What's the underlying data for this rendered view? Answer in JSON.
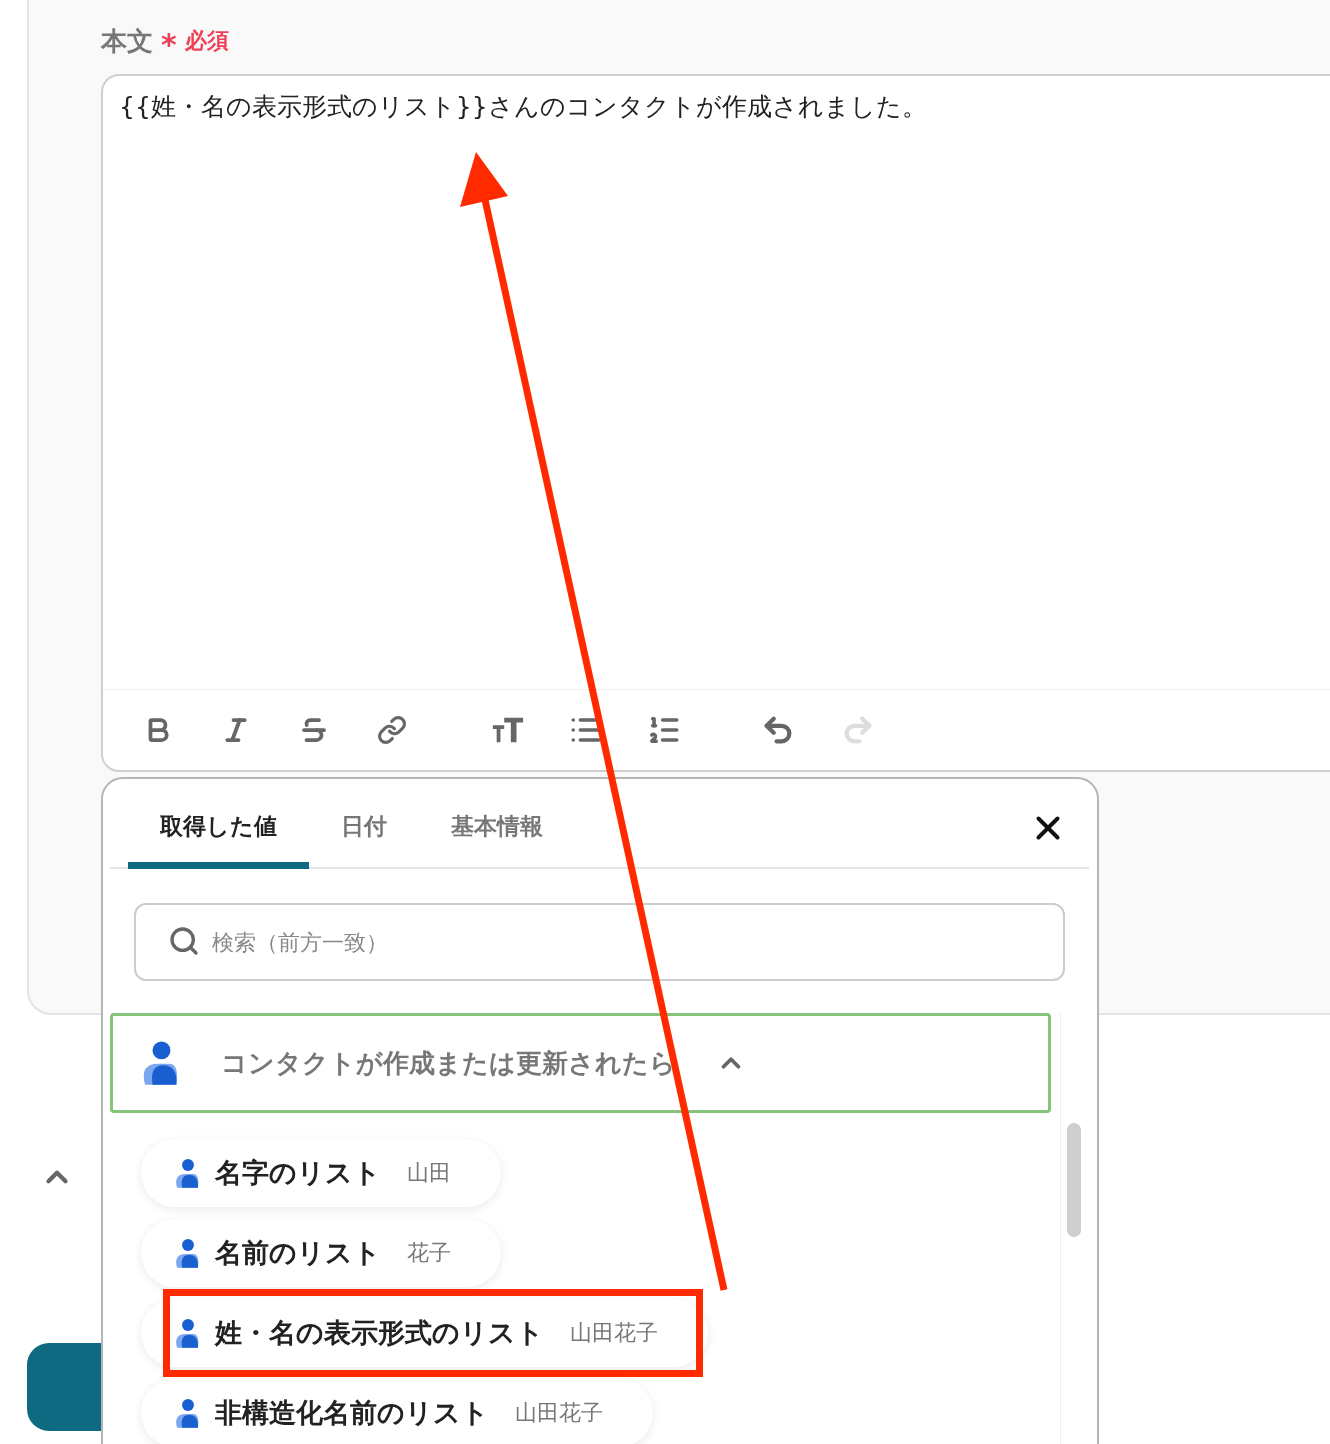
{
  "field": {
    "label": "本文",
    "required_mark": "*",
    "required_text": "必須",
    "value": "{{姓・名の表示形式のリスト}}さんのコンタクトが作成されました。"
  },
  "toolbar": [
    {
      "kind": "bold",
      "disabled": false
    },
    {
      "kind": "italic",
      "disabled": false
    },
    {
      "kind": "strike",
      "disabled": false
    },
    {
      "kind": "link",
      "disabled": false
    },
    {
      "kind": "size",
      "disabled": false
    },
    {
      "kind": "bullets",
      "disabled": false
    },
    {
      "kind": "numbers",
      "disabled": false
    },
    {
      "kind": "undo",
      "disabled": false
    },
    {
      "kind": "redo",
      "disabled": true
    }
  ],
  "popup": {
    "tabs": [
      {
        "label": "取得した値",
        "selected": true
      },
      {
        "label": "日付",
        "selected": false
      },
      {
        "label": "基本情報",
        "selected": false
      }
    ],
    "search": {
      "placeholder": "検索（前方一致）"
    },
    "group": {
      "title": "コンタクトが作成または更新されたら",
      "expanded": true
    },
    "items": [
      {
        "label": "名字のリスト",
        "value": "山田",
        "highlighted": false
      },
      {
        "label": "名前のリスト",
        "value": "花子",
        "highlighted": false
      },
      {
        "label": "姓・名の表示形式のリスト",
        "value": "山田花子",
        "highlighted": true
      },
      {
        "label": "非構造化名前のリスト",
        "value": "山田花子",
        "highlighted": false
      }
    ]
  }
}
